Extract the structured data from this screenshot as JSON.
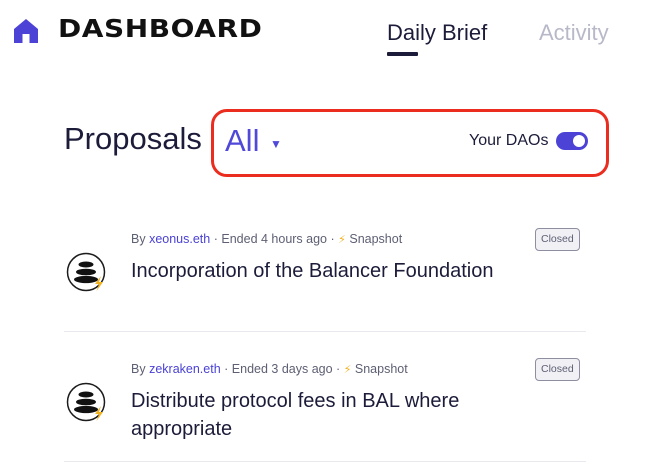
{
  "header": {
    "brand": "DASHBOARD",
    "tabs": [
      {
        "label": "Daily Brief",
        "active": true
      },
      {
        "label": "Activity",
        "active": false
      }
    ]
  },
  "proposals": {
    "title": "Proposals",
    "filter_value": "All",
    "your_daos_label": "Your DAOs",
    "your_daos_enabled": true,
    "items": [
      {
        "by_prefix": "By",
        "author": "xeonus.eth",
        "ended": "· Ended 4 hours ago ·",
        "source": "Snapshot",
        "title": "Incorporation of the Balancer Foundation",
        "status": "Closed"
      },
      {
        "by_prefix": "By",
        "author": "zekraken.eth",
        "ended": "· Ended 3 days ago ·",
        "source": "Snapshot",
        "title": "Distribute protocol fees in BAL where appropriate",
        "status": "Closed"
      }
    ]
  },
  "colors": {
    "accent": "#4c43d6",
    "highlight": "#ea2d1f",
    "snapshot_bolt": "#f2b21e"
  },
  "icons": {
    "home": "home-icon",
    "caret": "caret-down-icon",
    "dao": "balancer-logo-icon",
    "bolt": "lightning-bolt-icon"
  }
}
